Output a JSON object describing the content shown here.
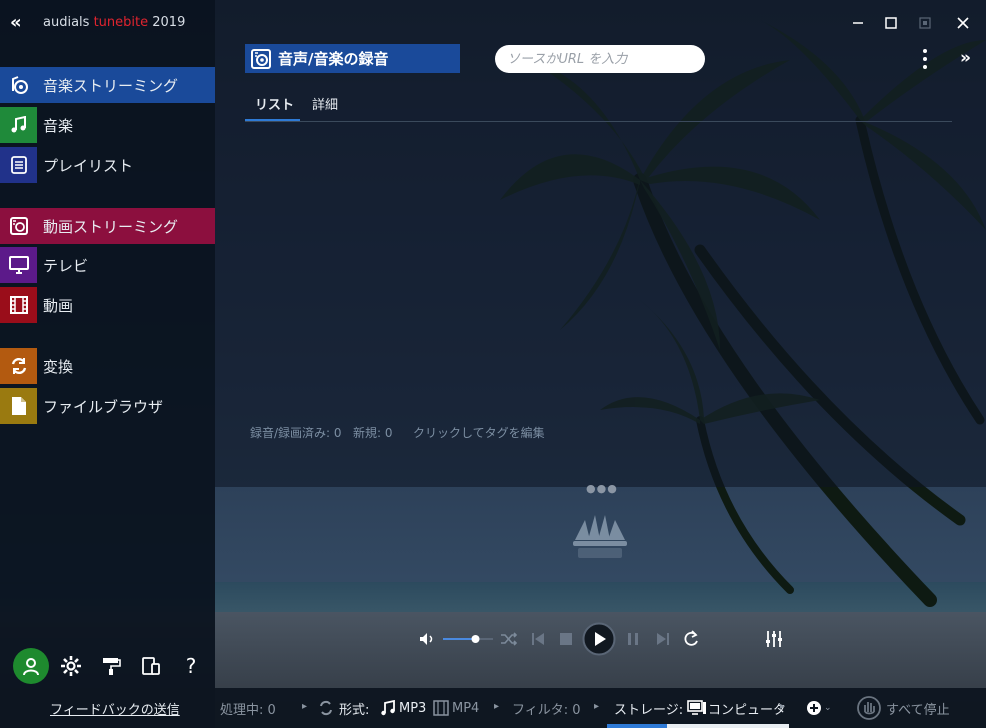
{
  "app": {
    "brand_prefix": "audials",
    "brand_highlight": "tunebite",
    "brand_suffix": "2019"
  },
  "sidebar": {
    "items": [
      {
        "label": "音楽ストリーミング",
        "icon": "music-streaming-icon",
        "color": "#1a4a9a"
      },
      {
        "label": "音楽",
        "icon": "music-note-icon",
        "color": "#1f8a3a"
      },
      {
        "label": "プレイリスト",
        "icon": "playlist-icon",
        "color": "#21328a"
      },
      {
        "label": "動画ストリーミング",
        "icon": "video-streaming-icon",
        "color": "#8c0f3e"
      },
      {
        "label": "テレビ",
        "icon": "tv-icon",
        "color": "#5c1a8a"
      },
      {
        "label": "動画",
        "icon": "film-icon",
        "color": "#9a0d1a"
      },
      {
        "label": "変換",
        "icon": "convert-icon",
        "color": "#b35a10"
      },
      {
        "label": "ファイルブラウザ",
        "icon": "file-browser-icon",
        "color": "#9a7a10"
      }
    ],
    "feedback_label": "フィードバックの送信"
  },
  "main": {
    "title": "音声/音楽の録音",
    "search_placeholder": "ソースかURL を入力",
    "tabs": [
      {
        "label": "リスト",
        "active": true
      },
      {
        "label": "詳細",
        "active": false
      }
    ],
    "status": {
      "recorded": "録音/録画済み: 0",
      "new": "新規: 0",
      "edit_tags": "クリックしてタグを編集"
    }
  },
  "bottombar": {
    "processing": "処理中: 0",
    "format_label": "形式:",
    "format_mp3": "MP3",
    "format_mp4": "MP4",
    "filter": "フィルタ: 0",
    "storage_label": "ストレージ:",
    "storage_value": "コンピュータ",
    "stop_all": "すべて停止"
  },
  "player": {
    "volume": 0.65
  },
  "colors": {
    "accent_blue": "#1a4a9a",
    "accent_red": "#8c0f3e",
    "brand_red": "#e0242f",
    "user_green": "#1e8a2e"
  }
}
